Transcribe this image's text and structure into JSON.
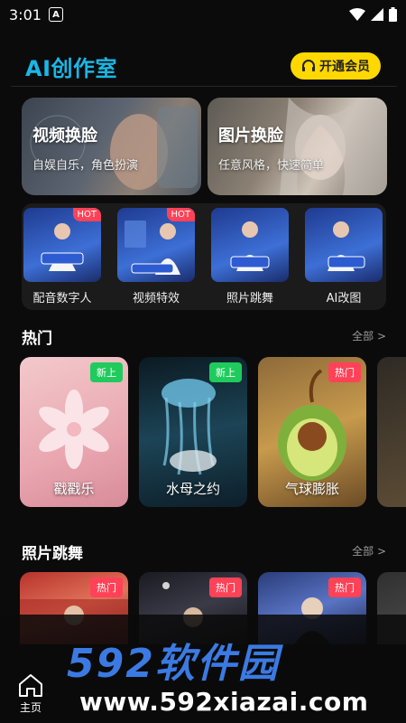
{
  "status_bar": {
    "time": "3:01",
    "indicator": "A"
  },
  "header": {
    "title": "AI创作室",
    "vip_button": "开通会员"
  },
  "feature_cards": [
    {
      "title": "视频换脸",
      "subtitle": "自娱自乐，角色扮演"
    },
    {
      "title": "图片换脸",
      "subtitle": "任意风格，快速简单"
    }
  ],
  "tools": [
    {
      "label": "配音数字人",
      "badge": "HOT",
      "inner": "创建数字人"
    },
    {
      "label": "视频特效",
      "badge": "HOT",
      "inner": "视频特效添加"
    },
    {
      "label": "照片跳舞",
      "badge": "",
      "inner": "照片跳舞"
    },
    {
      "label": "AI改图",
      "badge": "",
      "inner": "AI改图"
    }
  ],
  "hot_section": {
    "title": "热门",
    "more": "全部 >",
    "cards": [
      {
        "name": "戳戳乐",
        "tag": "新上"
      },
      {
        "name": "水母之约",
        "tag": "新上"
      },
      {
        "name": "气球膨胀",
        "tag": "热门"
      }
    ]
  },
  "dance_section": {
    "title": "照片跳舞",
    "more": "全部 >",
    "cards": [
      {
        "tag": "热门"
      },
      {
        "tag": "热门"
      },
      {
        "tag": "热门"
      }
    ]
  },
  "bottom_nav": {
    "home": "主页"
  },
  "watermark": {
    "brand": "592软件园",
    "url": "www.592xiazai.com"
  },
  "colors": {
    "accent": "#19b7e6",
    "vip": "#ffd800",
    "hot": "#ff4257",
    "new": "#1fcb5c",
    "watermark": "#3b7ae3"
  }
}
